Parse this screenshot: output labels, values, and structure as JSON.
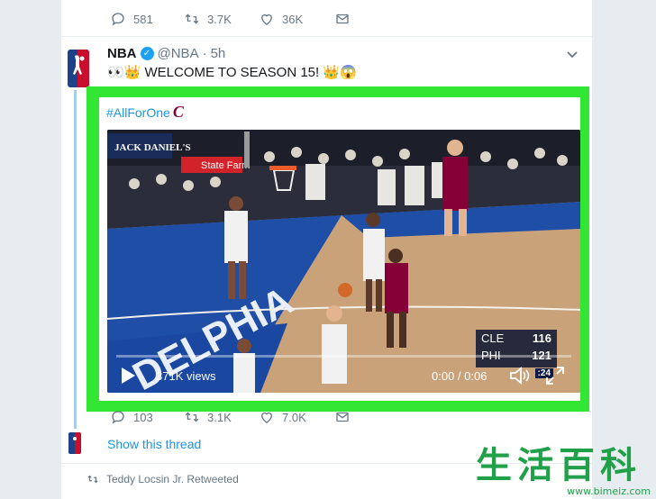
{
  "top_actions": {
    "replies": "581",
    "retweets": "3.7K",
    "likes": "36K"
  },
  "tweet": {
    "display_name": "NBA",
    "handle": "@NBA",
    "separator": "·",
    "time": "5h",
    "text": "👀👑 WELCOME TO SEASON 15! 👑😱",
    "hashtag": "#AllForOne",
    "hashtag_emoji": "C"
  },
  "video": {
    "views": "371K views",
    "time": "0:00 / 0:06",
    "sponsor1": "JACK DANIEL'S",
    "sponsor2": "State Farm",
    "score": [
      {
        "team": "CLE",
        "points": "116"
      },
      {
        "team": "PHI",
        "points": "121"
      }
    ],
    "score_sub": ":24",
    "progress": 0
  },
  "bottom_actions": {
    "replies": "103",
    "retweets": "3.1K",
    "likes": "7.0K"
  },
  "show_thread": "Show this thread",
  "retweeted_by": "Teddy Locsin Jr. Retweeted",
  "watermark": {
    "chars": [
      "生",
      "活",
      "百",
      "科"
    ],
    "url": "www.bimeiz.com"
  },
  "colors": {
    "highlight": "#33e633",
    "link": "#1b95e0",
    "muted": "#657786"
  },
  "icons": [
    "reply-icon",
    "retweet-icon",
    "like-icon",
    "message-icon",
    "chevron-down-icon",
    "play-icon",
    "volume-icon",
    "fullscreen-icon",
    "verified-icon"
  ]
}
